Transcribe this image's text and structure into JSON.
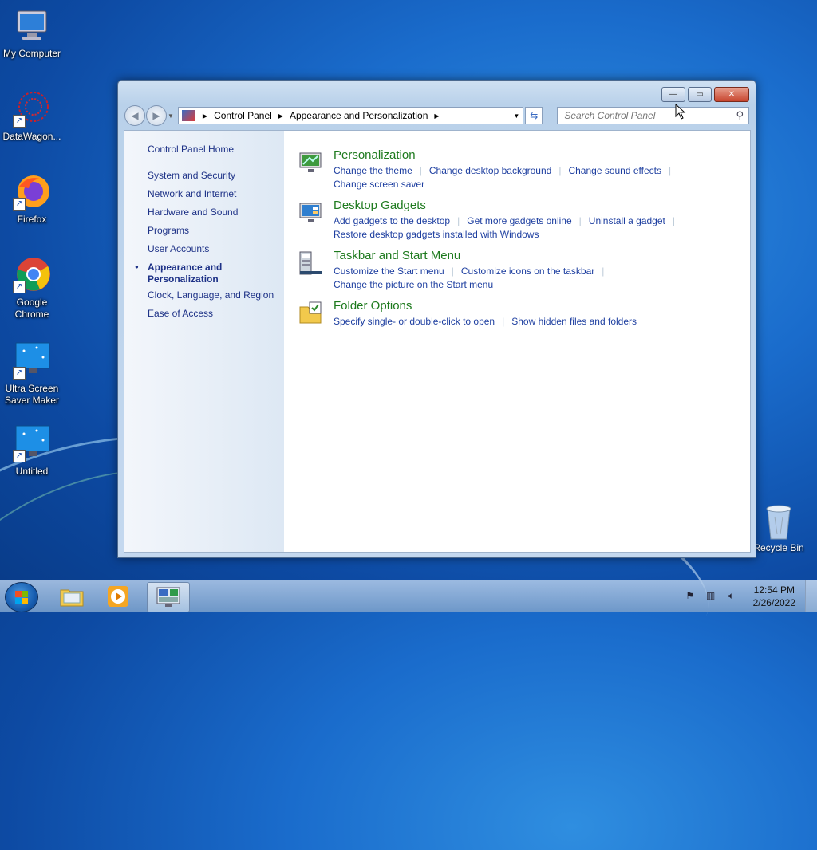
{
  "desktop": {
    "icons": [
      {
        "label": "My Computer"
      },
      {
        "label": "DataWagon..."
      },
      {
        "label": "Firefox"
      },
      {
        "label": "Google Chrome"
      },
      {
        "label": "Ultra Screen Saver Maker"
      },
      {
        "label": "Untitled"
      }
    ],
    "recycle_bin": "Recycle Bin"
  },
  "window": {
    "controls": {
      "minimize": "—",
      "maximize": "▭",
      "close": "✕"
    },
    "breadcrumb": [
      "Control Panel",
      "Appearance and Personalization"
    ],
    "search_placeholder": "Search Control Panel",
    "sidebar": {
      "home": "Control Panel Home",
      "items": [
        "System and Security",
        "Network and Internet",
        "Hardware and Sound",
        "Programs",
        "User Accounts",
        "Appearance and Personalization",
        "Clock, Language, and Region",
        "Ease of Access"
      ]
    },
    "categories": [
      {
        "title": "Personalization",
        "icon": "personalization-icon",
        "links": [
          "Change the theme",
          "Change desktop background",
          "Change sound effects",
          "Change screen saver"
        ]
      },
      {
        "title": "Desktop Gadgets",
        "icon": "gadgets-icon",
        "links": [
          "Add gadgets to the desktop",
          "Get more gadgets online",
          "Uninstall a gadget",
          "Restore desktop gadgets installed with Windows"
        ]
      },
      {
        "title": "Taskbar and Start Menu",
        "icon": "taskbar-icon",
        "links": [
          "Customize the Start menu",
          "Customize icons on the taskbar",
          "Change the picture on the Start menu"
        ]
      },
      {
        "title": "Folder Options",
        "icon": "folder-options-icon",
        "links": [
          "Specify single- or double-click to open",
          "Show hidden files and folders"
        ]
      }
    ]
  },
  "taskbar": {
    "clock_time": "12:54 PM",
    "clock_date": "2/26/2022"
  },
  "colors": {
    "link": "#1e3fa0",
    "category_title": "#1e7a1e",
    "sidebar_link": "#1e3287"
  }
}
